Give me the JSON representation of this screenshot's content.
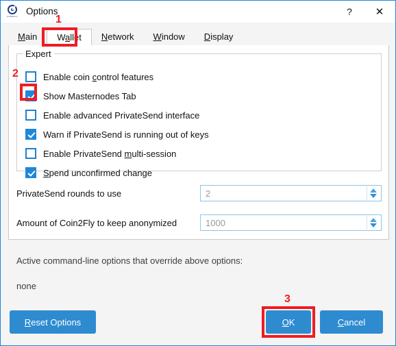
{
  "window": {
    "title": "Options",
    "icon": "app-logo-icon",
    "icon_subtext": "COIN2FLY",
    "help_button": "?",
    "close_button": "✕"
  },
  "tabs": [
    {
      "label": "Main",
      "mnemonic": "M",
      "active": false
    },
    {
      "label": "Wallet",
      "mnemonic": "a",
      "active": true
    },
    {
      "label": "Network",
      "mnemonic": "N",
      "active": false
    },
    {
      "label": "Window",
      "mnemonic": "W",
      "active": false
    },
    {
      "label": "Display",
      "mnemonic": "D",
      "active": false
    }
  ],
  "group": {
    "title": "Expert",
    "checkboxes": [
      {
        "label": "Enable coin control features",
        "mnemonic": "c",
        "checked": false
      },
      {
        "label": "Show Masternodes Tab",
        "mnemonic": "",
        "checked": true
      },
      {
        "label": "Enable advanced PrivateSend interface",
        "mnemonic": "",
        "checked": false
      },
      {
        "label": "Warn if PrivateSend is running out of keys",
        "mnemonic": "",
        "checked": true
      },
      {
        "label": "Enable PrivateSend multi-session",
        "mnemonic": "m",
        "checked": false
      },
      {
        "label": "Spend unconfirmed change",
        "mnemonic": "S",
        "checked": true
      }
    ]
  },
  "spinners": [
    {
      "label": "PrivateSend rounds to use",
      "value": "2"
    },
    {
      "label": "Amount of Coin2Fly to keep anonymized",
      "value": "1000"
    }
  ],
  "command_line": {
    "heading": "Active command-line options that override above options:",
    "value": "none"
  },
  "buttons": {
    "reset": {
      "label": "Reset Options",
      "mnemonic": "R"
    },
    "ok": {
      "label": "OK",
      "mnemonic": "O"
    },
    "cancel": {
      "label": "Cancel",
      "mnemonic": "C"
    }
  },
  "annotations": {
    "markers": [
      {
        "text": "1"
      },
      {
        "text": "2"
      },
      {
        "text": "3"
      }
    ],
    "color": "#ee1c24"
  },
  "colors": {
    "accent": "#2e8bd0",
    "checkbox": "#1f87d8",
    "window_border": "#1e87d8",
    "annotation": "#ee1c24",
    "background": "#f4f4f4"
  }
}
